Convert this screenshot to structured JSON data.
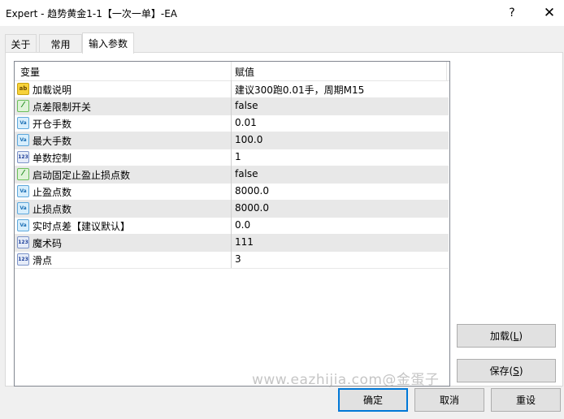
{
  "window": {
    "title": "Expert - 趋势黄金1-1【一次一单】-EA",
    "help_label": "?",
    "close_label": "✕"
  },
  "tabs": [
    {
      "label": "关于"
    },
    {
      "label": "常用"
    },
    {
      "label": "输入参数"
    }
  ],
  "grid": {
    "columns": {
      "variable": "变量",
      "value": "赋值"
    },
    "rows": [
      {
        "icon": "ab",
        "name": "加载说明",
        "value": "建议300跑0.01手，周期M15"
      },
      {
        "icon": "bool",
        "name": "点差限制开关",
        "value": "false"
      },
      {
        "icon": "double",
        "name": "开仓手数",
        "value": "0.01"
      },
      {
        "icon": "double",
        "name": "最大手数",
        "value": "100.0"
      },
      {
        "icon": "int",
        "name": "单数控制",
        "value": "1"
      },
      {
        "icon": "bool",
        "name": "启动固定止盈止损点数",
        "value": "false"
      },
      {
        "icon": "double",
        "name": "止盈点数",
        "value": "8000.0"
      },
      {
        "icon": "double",
        "name": "止损点数",
        "value": "8000.0"
      },
      {
        "icon": "double",
        "name": "实时点差【建议默认】",
        "value": "0.0"
      },
      {
        "icon": "int",
        "name": "魔术码",
        "value": "111"
      },
      {
        "icon": "int",
        "name": "滑点",
        "value": "3"
      }
    ]
  },
  "buttons": {
    "load": {
      "label": "加载(",
      "key": "L",
      "suffix": ")"
    },
    "save": {
      "label": "保存(",
      "key": "S",
      "suffix": ")"
    },
    "ok": "确定",
    "cancel": "取消",
    "reset": "重设"
  },
  "watermark": "www.eazhijia.com@金蛋子",
  "icon_text": {
    "ab": "ab",
    "bool": "⁄",
    "double": "Va",
    "int": "123"
  }
}
